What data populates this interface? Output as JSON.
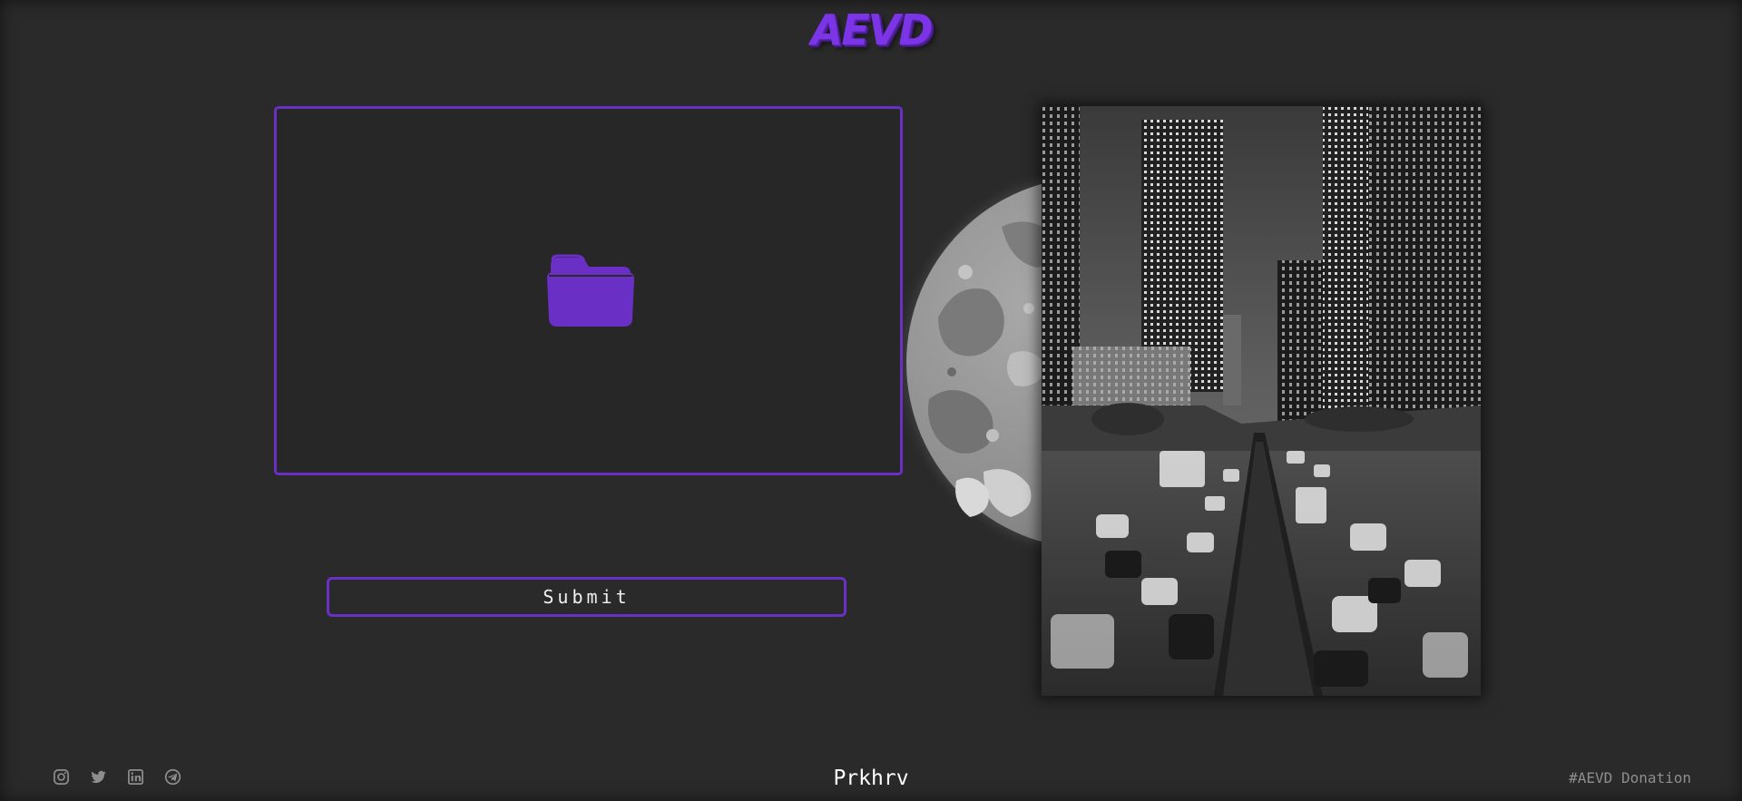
{
  "header": {
    "logo_text": "AEVD"
  },
  "upload": {
    "icon": "folder-icon"
  },
  "form": {
    "submit_label": "Submit"
  },
  "footer": {
    "social_icons": [
      "instagram-icon",
      "twitter-icon",
      "linkedin-icon",
      "telegram-icon"
    ],
    "author": "Prkhrv",
    "donation_link": "#AEVD Donation"
  },
  "colors": {
    "accent": "#6a2fc4",
    "logo": "#7b35e6",
    "background": "#2a2a2a",
    "icon_gray": "#8e8e8e"
  }
}
